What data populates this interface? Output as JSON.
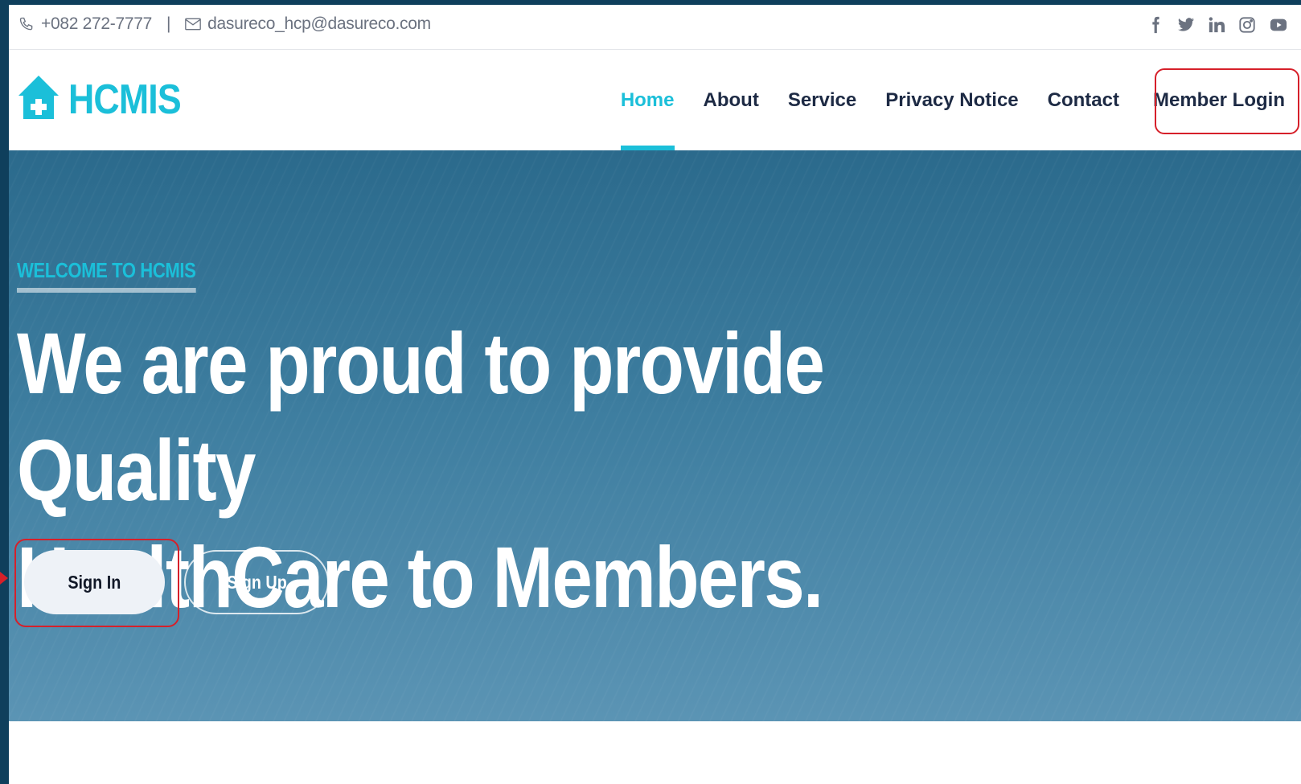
{
  "topbar": {
    "phone": "+082 272-7777",
    "separator": "|",
    "email": "dasureco_hcp@dasureco.com",
    "social_icons": [
      "facebook-icon",
      "twitter-icon",
      "linkedin-icon",
      "instagram-icon",
      "youtube-icon"
    ]
  },
  "brand": {
    "name": "HCMIS",
    "color": "#1bbfd9"
  },
  "nav": {
    "items": [
      {
        "label": "Home",
        "active": true
      },
      {
        "label": "About",
        "active": false
      },
      {
        "label": "Service",
        "active": false
      },
      {
        "label": "Privacy Notice",
        "active": false
      },
      {
        "label": "Contact",
        "active": false
      },
      {
        "label": "Member Login",
        "active": false
      }
    ]
  },
  "hero": {
    "kicker": "WELCOME TO HCMIS",
    "headline_line1": "We are proud to provide Quality",
    "headline_line2": "HealthCare to Members.",
    "signin_label": "Sign In",
    "signup_label": "Sign Up"
  },
  "colors": {
    "accent": "#1bbfd9",
    "nav_text": "#1d2a44",
    "annotation": "#d6202a"
  }
}
